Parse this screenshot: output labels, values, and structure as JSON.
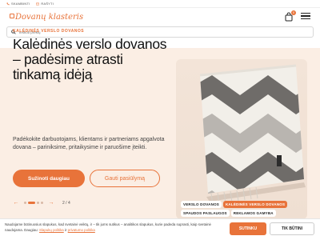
{
  "topbar": {
    "contacts": [
      {
        "icon": "phone-icon",
        "text": "SKAMBINTI"
      },
      {
        "icon": "mail-icon",
        "text": "RAŠYTI"
      }
    ]
  },
  "header": {
    "logo_text": "Dovanų klasteris",
    "cart_count": "0"
  },
  "search": {
    "placeholder": "Ieškoti prekių"
  },
  "hero": {
    "eyebrow": "KALĖDINĖS VERSLO DOVANOS",
    "headline": "Kalėdinės verslo dovanos – padėsime atrasti tinkamą idėją",
    "description": "Padėkokite darbuotojams, klientams ir partneriams apgalvota dovana – pariniksime, pritaikysime ir paruošime įteikti.",
    "primary_button": "Sužinoti daugiau",
    "secondary_button": "Gauti pasiūlymą",
    "slide_counter": "2 / 4",
    "tags": [
      "VERSLO DOVANOS",
      "KALĖDINĖS VERSLO DOVANOS",
      "SPAUDOS PASLAUGOS",
      "REKLAMOS GAMYBA"
    ]
  },
  "cookie": {
    "text_before": "Naudojame būtinuosius slapukus, kad svetainė veiktų, ir – tik jums sutikus – analitikos slapukus, kurie padeda suprasti, kaip svetainė naudojama. Daugiau:",
    "link1": "Slapukų politika",
    "joiner": "ir",
    "link2": "privatumo politika",
    "accept": "SUTINKU",
    "essential": "TIK BŪTINI"
  },
  "colors": {
    "accent": "#e8733a",
    "hero_bg": "#fbeee4"
  }
}
